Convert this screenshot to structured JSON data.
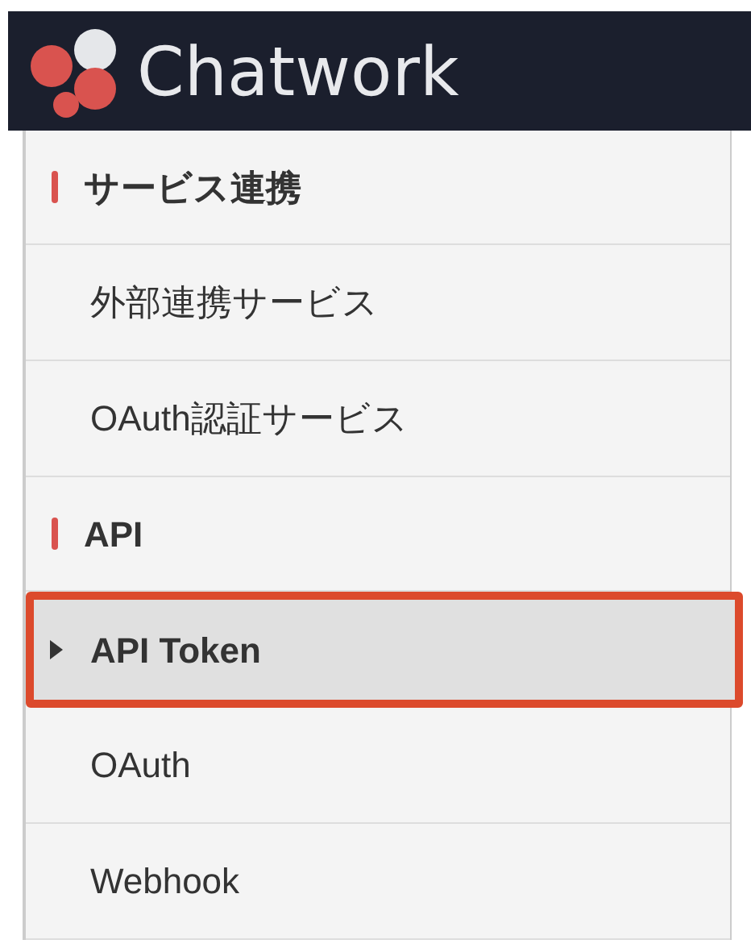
{
  "header": {
    "logo_text": "Chatwork"
  },
  "menu": [
    {
      "kind": "heading",
      "label": "サービス連携"
    },
    {
      "kind": "item",
      "label": "外部連携サービス",
      "selected": false
    },
    {
      "kind": "item",
      "label": "OAuth認証サービス",
      "selected": false
    },
    {
      "kind": "heading",
      "label": "API"
    },
    {
      "kind": "item",
      "label": "API Token",
      "selected": true
    },
    {
      "kind": "item",
      "label": "OAuth",
      "selected": false
    },
    {
      "kind": "item",
      "label": "Webhook",
      "selected": false
    }
  ]
}
